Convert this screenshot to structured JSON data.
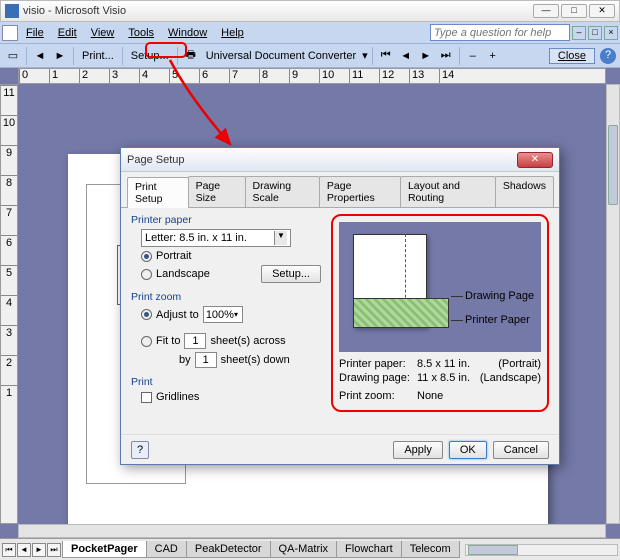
{
  "window": {
    "title": "visio - Microsoft Visio"
  },
  "menu": {
    "file": "File",
    "edit": "Edit",
    "view": "View",
    "tools": "Tools",
    "window": "Window",
    "help": "Help"
  },
  "helpbox": {
    "placeholder": "Type a question for help"
  },
  "toolbar": {
    "print": "Print...",
    "setup": "Setup...",
    "converter": "Universal Document Converter",
    "close": "Close"
  },
  "dialog": {
    "title": "Page Setup",
    "tabs": [
      "Print Setup",
      "Page Size",
      "Drawing Scale",
      "Page Properties",
      "Layout and Routing",
      "Shadows"
    ],
    "printer_paper": {
      "title": "Printer paper",
      "size": "Letter: 8.5 in. x 11 in.",
      "portrait": "Portrait",
      "landscape": "Landscape",
      "setup_btn": "Setup..."
    },
    "print_zoom": {
      "title": "Print zoom",
      "adjust": "Adjust to",
      "adjust_val": "100%",
      "fit": "Fit to",
      "fit_across_val": "1",
      "across": "sheet(s) across",
      "by": "by",
      "fit_down_val": "1",
      "down": "sheet(s) down"
    },
    "print": {
      "title": "Print",
      "gridlines": "Gridlines"
    },
    "preview": {
      "drawing_page_label": "Drawing Page",
      "printer_paper_label": "Printer Paper",
      "info": {
        "pp_k": "Printer paper:",
        "pp_v": "8.5 x 11 in.",
        "pp_o": "(Portrait)",
        "dp_k": "Drawing page:",
        "dp_v": "11 x 8.5 in.",
        "dp_o": "(Landscape)",
        "pz_k": "Print zoom:",
        "pz_v": "None"
      }
    },
    "buttons": {
      "apply": "Apply",
      "ok": "OK",
      "cancel": "Cancel"
    }
  },
  "sheet_tabs": [
    "PocketPager",
    "CAD",
    "PeakDetector",
    "QA-Matrix",
    "Flowchart",
    "Telecom"
  ],
  "ruler_h": [
    "0",
    "1",
    "2",
    "3",
    "4",
    "5",
    "6",
    "7",
    "8",
    "9",
    "10",
    "11",
    "12",
    "13",
    "14"
  ],
  "ruler_v": [
    "11",
    "10",
    "9",
    "8",
    "7",
    "6",
    "5",
    "4",
    "3",
    "2",
    "1"
  ]
}
